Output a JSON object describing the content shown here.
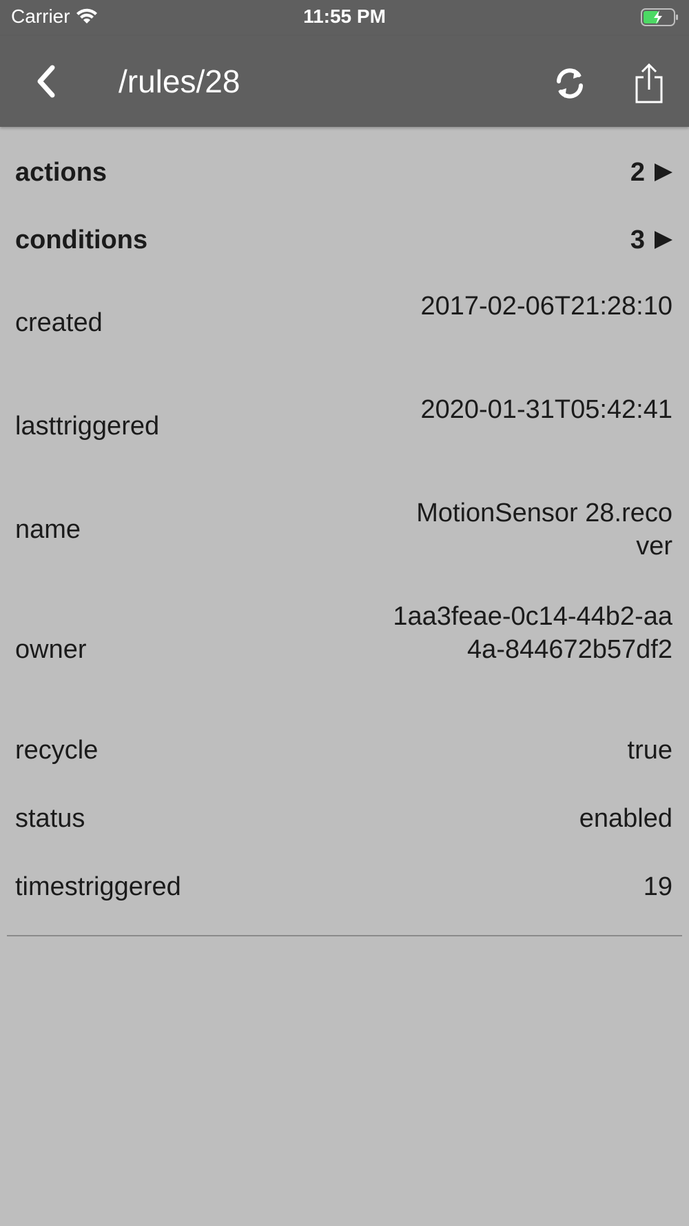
{
  "status_bar": {
    "carrier": "Carrier",
    "time": "11:55 PM",
    "battery_state": "charging",
    "battery_color": "#4cd964"
  },
  "nav": {
    "title": "/rules/28",
    "back_icon": "chevron-left-icon",
    "refresh_icon": "refresh-icon",
    "share_icon": "share-icon"
  },
  "rows": {
    "actions": {
      "key": "actions",
      "value": "2"
    },
    "conditions": {
      "key": "conditions",
      "value": "3"
    },
    "created": {
      "key": "created",
      "value": "2017-02-06T21:28:10"
    },
    "lasttriggered": {
      "key": "lasttriggered",
      "value": "2020-01-31T05:42:41"
    },
    "name": {
      "key": "name",
      "value": "MotionSensor 28.recover"
    },
    "owner": {
      "key": "owner",
      "value": "1aa3feae-0c14-44b2-aa4a-844672b57df2"
    },
    "recycle": {
      "key": "recycle",
      "value": "true"
    },
    "status": {
      "key": "status",
      "value": "enabled"
    },
    "timestriggered": {
      "key": "timestriggered",
      "value": "19"
    }
  },
  "colors": {
    "bar_background": "#5f5f5f",
    "page_background": "#bebebe",
    "text": "#1b1b1b"
  }
}
